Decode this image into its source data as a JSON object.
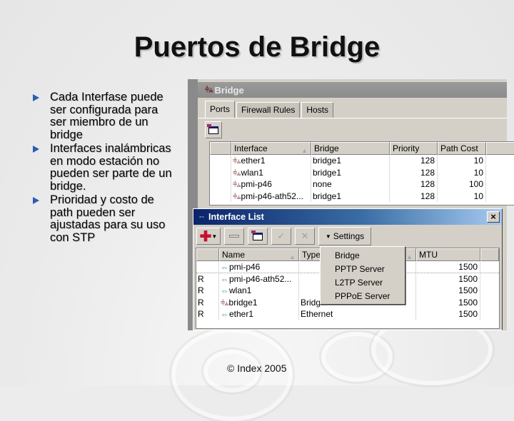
{
  "slide": {
    "title": "Puertos de Bridge",
    "bullets": [
      "Cada Interfase puede ser configurada para ser miembro de un bridge",
      "Interfaces inalámbricas en modo estación no pueden ser parte de un bridge.",
      "Prioridad y costo de path pueden ser ajustadas para su uso con STP"
    ],
    "footer": "© Index 2005"
  },
  "bridge_window": {
    "title": "Bridge",
    "tabs": [
      "Ports",
      "Firewall Rules",
      "Hosts"
    ],
    "active_tab": "Ports",
    "columns": [
      "Interface",
      "Bridge",
      "Priority",
      "Path Cost"
    ],
    "rows": [
      {
        "interface": "ether1",
        "bridge": "bridge1",
        "priority": "128",
        "path_cost": "10"
      },
      {
        "interface": "wlan1",
        "bridge": "bridge1",
        "priority": "128",
        "path_cost": "10"
      },
      {
        "interface": "pmi-p46",
        "bridge": "none",
        "priority": "128",
        "path_cost": "100"
      },
      {
        "interface": "pmi-p46-ath52...",
        "bridge": "bridge1",
        "priority": "128",
        "path_cost": "10"
      }
    ]
  },
  "interface_list": {
    "title": "Interface List",
    "close_label": "×",
    "settings_label": "Settings",
    "columns": [
      "Name",
      "Type",
      "MTU"
    ],
    "rows": [
      {
        "flag": "",
        "name": "pmi-p46",
        "icon": "ethernet-icon",
        "type": "",
        "mtu": "1500"
      },
      {
        "flag": "R",
        "name": "pmi-p46-ath52...",
        "icon": "ethernet-icon",
        "type": "",
        "mtu": "1500"
      },
      {
        "flag": "R",
        "name": "wlan1",
        "icon": "ethernet-icon",
        "type": "",
        "mtu": "1500"
      },
      {
        "flag": "R",
        "name": "bridge1",
        "icon": "bridge-icon",
        "type": "Bridge",
        "mtu": "1500"
      },
      {
        "flag": "R",
        "name": "ether1",
        "icon": "ethernet-icon",
        "type": "Ethernet",
        "mtu": "1500"
      }
    ],
    "settings_menu": [
      "Bridge",
      "PPTP Server",
      "L2TP Server",
      "PPPoE Server"
    ]
  }
}
